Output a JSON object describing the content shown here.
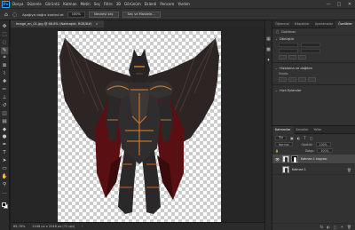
{
  "app": {
    "logo_text": "Ps"
  },
  "menubar": {
    "items": [
      "Dosya",
      "Düzenle",
      "Görüntü",
      "Katman",
      "Metin",
      "Seç",
      "Filtre",
      "3B",
      "Görünüm",
      "Eklenti",
      "Pencere",
      "Yardım"
    ],
    "window_controls": [
      "—",
      "□",
      "✕"
    ]
  },
  "options_bar": {
    "home_icon": "⌂",
    "tool_icon": "◌",
    "auto_select_label": "Aşağıya doğru kontrol et",
    "sample_field": "100%",
    "select_subject_button": "Nesneyi seç",
    "select_and_mask_button": "Seç ve Maskele..."
  },
  "document_tab": {
    "label": "Image_en_01.jpg @ 66,8% (Nakkaşlık, RGB/8#)",
    "close_glyph": "×"
  },
  "status_bar": {
    "zoom": "66,78%",
    "doc_size": "2048 px x 2048 px (72 ppi)",
    "arrow": "›"
  },
  "right_tabs": {
    "tabs": [
      "Öğrenme",
      "Kitaplıklar",
      "Ayarlamalar",
      "Özellikler"
    ]
  },
  "properties": {
    "doc_label": "Doküman",
    "transform_label": "Dönüştür",
    "align_label": "Hizalama ve dağıtım",
    "align_sub": "Hizala:",
    "quick_actions_label": "Hızlı Eylemler"
  },
  "layers_panel": {
    "tabs": [
      "Katmanlar",
      "Kanallar",
      "Yollar"
    ],
    "filter_kind": "Tür",
    "blend_mode": "Normal",
    "opacity_label": "Opaklık:",
    "opacity_value": "100%",
    "fill_label": "Dolgu:",
    "fill_value": "100%",
    "layers": [
      {
        "name": "Katman 1 kopyası",
        "visible": true,
        "selected": true
      },
      {
        "name": "Katman 1",
        "visible": false,
        "selected": false
      }
    ],
    "footer_icons": [
      "fx",
      "◐",
      "▢",
      "+",
      "🗑"
    ]
  },
  "canvas": {
    "subject": "armored-knight-with-bat-wings",
    "background": "transparent-checkerboard"
  },
  "colors": {
    "accent": "#31a8ff",
    "panel_bg": "#323232",
    "workspace_bg": "#262626",
    "selection": "#474747"
  }
}
